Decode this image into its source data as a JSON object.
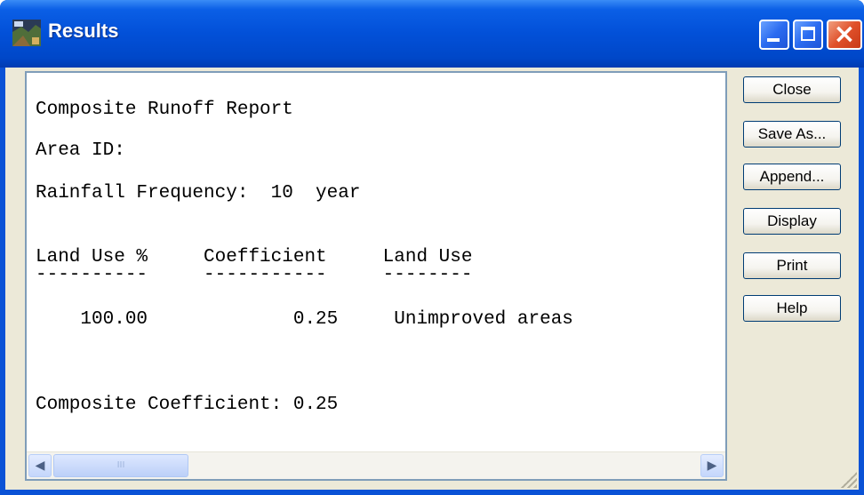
{
  "window": {
    "title": "Results",
    "icon": "app-icon",
    "controls": {
      "minimize": "minimize-icon",
      "maximize": "maximize-icon",
      "close": "close-icon",
      "close_glyph": "×"
    }
  },
  "report": {
    "title": "Composite Runoff Report",
    "area_id": "Area ID:",
    "rainfall_frequency": "Rainfall Frequency:  10  year",
    "table_header": "Land Use %     Coefficient     Land Use",
    "table_rule": "----------     -----------     --------",
    "table_rows": [
      "    100.00             0.25     Unimproved areas"
    ],
    "composite": "Composite Coefficient: 0.25"
  },
  "scrollbar": {
    "left_arrow": "◀",
    "right_arrow": "▶",
    "thumb_grip": "III"
  },
  "buttons": {
    "close": "Close",
    "save_as": "Save As...",
    "append": "Append...",
    "display": "Display",
    "print": "Print",
    "help": "Help"
  }
}
